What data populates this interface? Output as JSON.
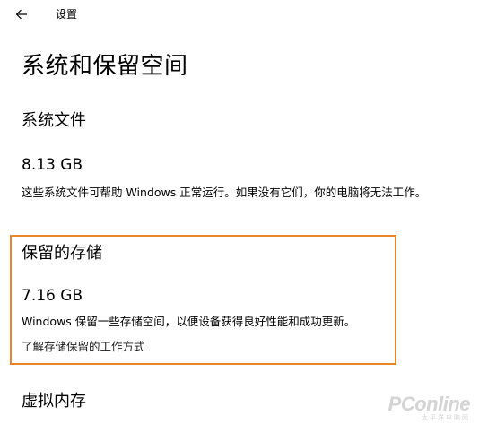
{
  "window": {
    "title": "设置",
    "back_icon": "arrow-left-icon"
  },
  "page": {
    "title": "系统和保留空间"
  },
  "system_files": {
    "heading": "系统文件",
    "size": "8.13 GB",
    "description": "这些系统文件可帮助 Windows 正常运行。如果没有它们，你的电脑将无法工作。"
  },
  "reserved_storage": {
    "heading": "保留的存储",
    "size": "7.16 GB",
    "description": "Windows 保留一些存储空间，以便设备获得良好性能和成功更新。",
    "link": "了解存储保留的工作方式",
    "highlight_color": "#e8862a"
  },
  "virtual_memory": {
    "heading": "虚拟内存"
  },
  "watermark": {
    "logo_text": "PConline",
    "sub_text": "太平洋电脑网"
  }
}
